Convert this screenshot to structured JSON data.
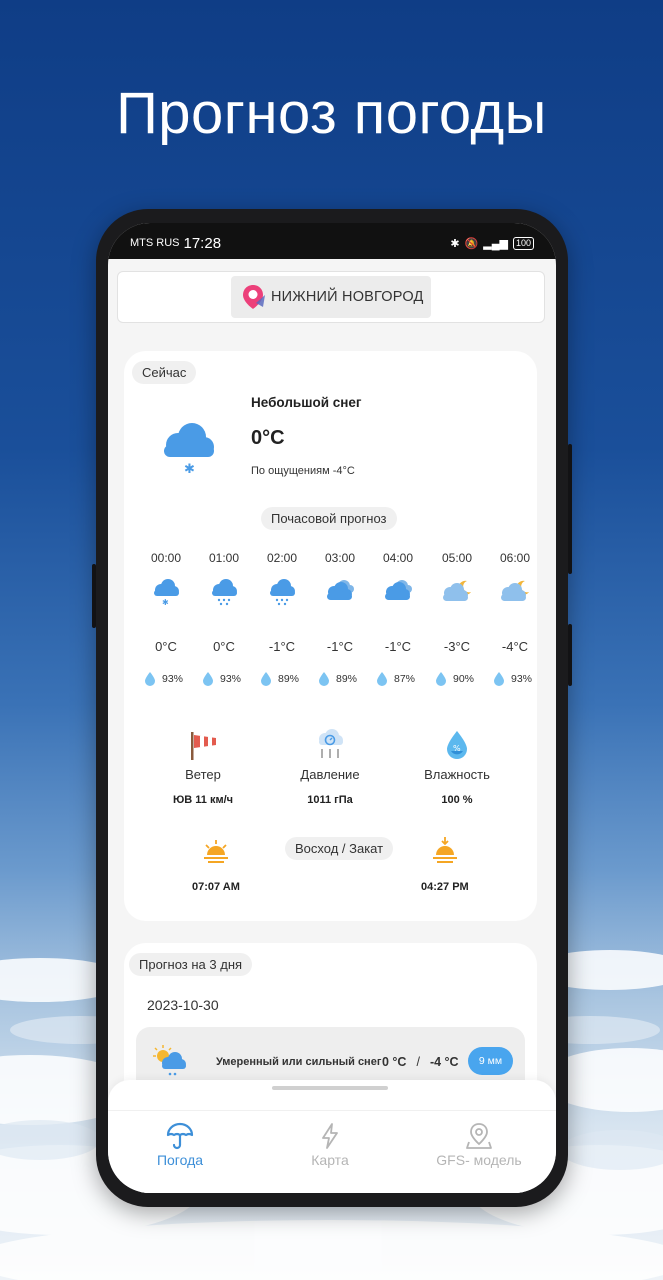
{
  "hero": {
    "title": "Прогноз погоды"
  },
  "status_bar": {
    "carrier": "MTS RUS",
    "time": "17:28",
    "battery": "100"
  },
  "location": {
    "city": "НИЖНИЙ НОВГОРОД"
  },
  "current": {
    "section_label": "Сейчас",
    "condition": "Небольшой снег",
    "temperature": "0°C",
    "feels_like": "По ощущениям -4°C",
    "icon": "cloud-snow-icon"
  },
  "hourly": {
    "section_label": "Почасовой прогноз",
    "hours": [
      {
        "time": "00:00",
        "temp": "0°C",
        "humidity": "93%",
        "icon": "cloud-snow-icon"
      },
      {
        "time": "01:00",
        "temp": "0°C",
        "humidity": "93%",
        "icon": "cloud-light-snow-icon"
      },
      {
        "time": "02:00",
        "temp": "-1°C",
        "humidity": "89%",
        "icon": "cloud-light-snow-icon"
      },
      {
        "time": "03:00",
        "temp": "-1°C",
        "humidity": "89%",
        "icon": "overcast-icon"
      },
      {
        "time": "04:00",
        "temp": "-1°C",
        "humidity": "87%",
        "icon": "overcast-icon"
      },
      {
        "time": "05:00",
        "temp": "-3°C",
        "humidity": "90%",
        "icon": "partly-cloudy-night-icon"
      },
      {
        "time": "06:00",
        "temp": "-4°C",
        "humidity": "93%",
        "icon": "partly-cloudy-night-icon"
      }
    ]
  },
  "details": {
    "wind": {
      "label": "Ветер",
      "value": "ЮВ 11 км/ч",
      "icon": "windsock-icon"
    },
    "pressure": {
      "label": "Давление",
      "value": "1011 гПа",
      "icon": "barometer-icon"
    },
    "humidity": {
      "label": "Влажность",
      "value": "100 %",
      "icon": "humidity-drop-icon"
    }
  },
  "sun": {
    "label": "Восход / Закат",
    "sunrise": "07:07 AM",
    "sunset": "04:27 PM"
  },
  "forecast": {
    "section_label": "Прогноз на 3 дня",
    "days": [
      {
        "date": "2023-10-30",
        "condition": "Умеренный или сильный снег",
        "max_temp": "0 °C",
        "separator": "/",
        "min_temp": "-4 °C",
        "precip": "9 мм",
        "icon": "sun-cloud-snow-icon"
      }
    ]
  },
  "nav": [
    {
      "label": "Погода",
      "icon": "umbrella-icon",
      "active": true
    },
    {
      "label": "Карта",
      "icon": "lightning-icon",
      "active": false
    },
    {
      "label": "GFS- модель",
      "icon": "map-pin-icon",
      "active": false
    }
  ],
  "colors": {
    "accent": "#3d8fd8",
    "inactive": "#b5b5b5",
    "badge": "#49a5ee"
  }
}
